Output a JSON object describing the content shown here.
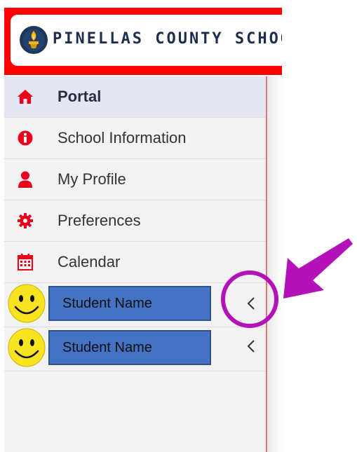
{
  "header": {
    "logo_text": "PINELLAS COUNTY SCHOOL",
    "brand_color": "#ff0000"
  },
  "nav": {
    "items": [
      {
        "label": "Portal",
        "icon": "home-icon"
      },
      {
        "label": "School Information",
        "icon": "info-icon"
      },
      {
        "label": "My Profile",
        "icon": "user-icon"
      },
      {
        "label": "Preferences",
        "icon": "gear-icon"
      },
      {
        "label": "Calendar",
        "icon": "calendar-icon"
      }
    ]
  },
  "students": [
    {
      "name": "Student Name",
      "avatar": "smiley-avatar",
      "expand_icon": "chevron-left-icon"
    },
    {
      "name": "Student Name",
      "avatar": "smiley-avatar",
      "expand_icon": "chevron-left-icon"
    }
  ],
  "colors": {
    "icon_red": "#e8001c",
    "student_box": "#4472c4",
    "annotation": "#b312b8"
  }
}
